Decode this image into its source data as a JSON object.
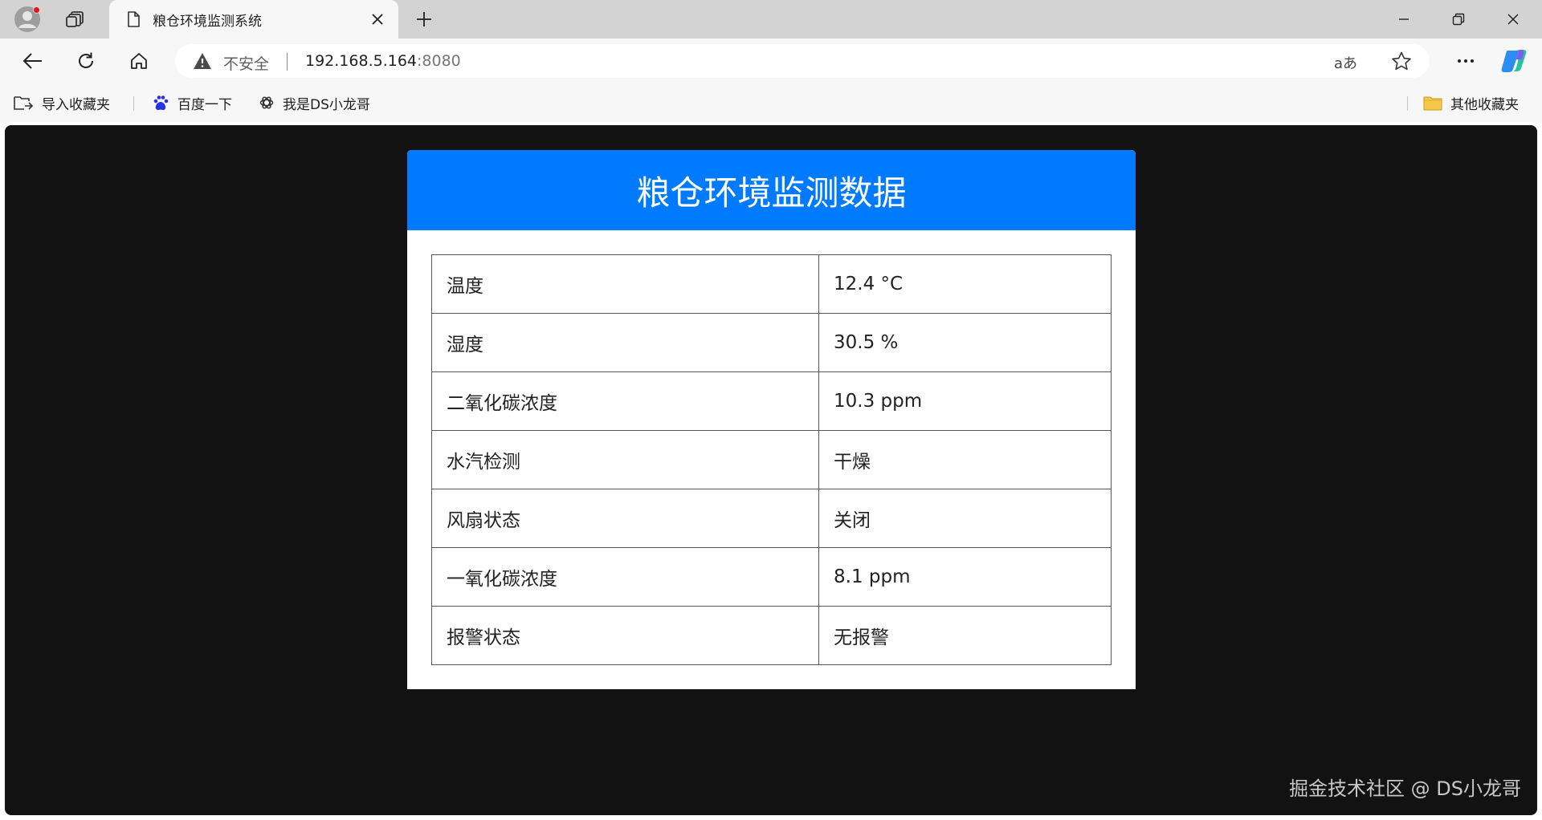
{
  "browser": {
    "tab": {
      "title": "粮仓环境监测系统"
    },
    "address": {
      "security_label": "不安全",
      "host": "192.168.5.164",
      "port": ":8080",
      "read_aloud_label": "aあ"
    },
    "favorites": [
      {
        "label": "导入收藏夹",
        "icon": "import-favorites-icon"
      },
      {
        "label": "百度一下",
        "icon": "baidu-paw-icon"
      },
      {
        "label": "我是DS小龙哥",
        "icon": "openai-icon"
      }
    ],
    "other_favorites_label": "其他收藏夹"
  },
  "page": {
    "title": "粮仓环境监测数据",
    "rows": [
      {
        "label": "温度",
        "value": "12.4 °C"
      },
      {
        "label": "湿度",
        "value": "30.5 %"
      },
      {
        "label": "二氧化碳浓度",
        "value": "10.3 ppm"
      },
      {
        "label": "水汽检测",
        "value": "干燥"
      },
      {
        "label": "风扇状态",
        "value": "关闭"
      },
      {
        "label": "一氧化碳浓度",
        "value": "8.1 ppm"
      },
      {
        "label": "报警状态",
        "value": "无报警"
      }
    ],
    "header_color": "#007bff",
    "background_color": "#121212"
  },
  "watermark": "掘金技术社区 @ DS小龙哥"
}
